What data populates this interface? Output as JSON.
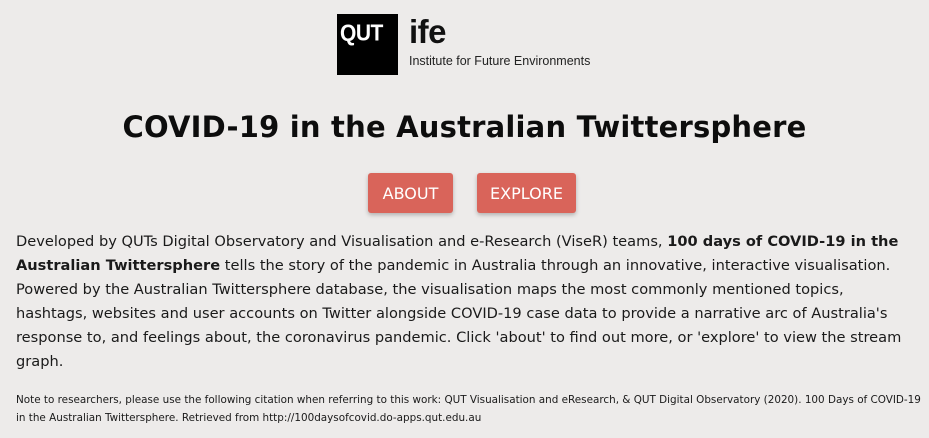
{
  "logo": {
    "qut": "QUT",
    "ife": "ife",
    "subtitle": "Institute for Future Environments"
  },
  "title": "COVID-19 in the Australian Twittersphere",
  "buttons": {
    "about": "ABOUT",
    "explore": "EXPLORE"
  },
  "description": {
    "intro": "Developed by QUTs Digital Observatory and Visualisation and e-Research (ViseR) teams, ",
    "bold": "100 days of COVID-19 in the Australian Twittersphere",
    "rest": " tells the story of the pandemic in Australia through an innovative, interactive visualisation. Powered by the Australian Twittersphere database, the visualisation maps the most commonly mentioned topics, hashtags, websites and user accounts on Twitter alongside COVID-19 case data to provide a narrative arc of Australia's response to, and feelings about, the coronavirus pandemic. Click 'about' to find out more, or 'explore' to view the stream graph."
  },
  "note": "Note to researchers, please use the following citation when referring to this work: QUT Visualisation and eResearch, & QUT Digital Observatory (2020). 100 Days of COVID-19 in the Australian Twittersphere. Retrieved from http://100daysofcovid.do-apps.qut.edu.au",
  "colors": {
    "background": "#edebea",
    "button": "#d9645a",
    "button_text": "#ffffff"
  }
}
